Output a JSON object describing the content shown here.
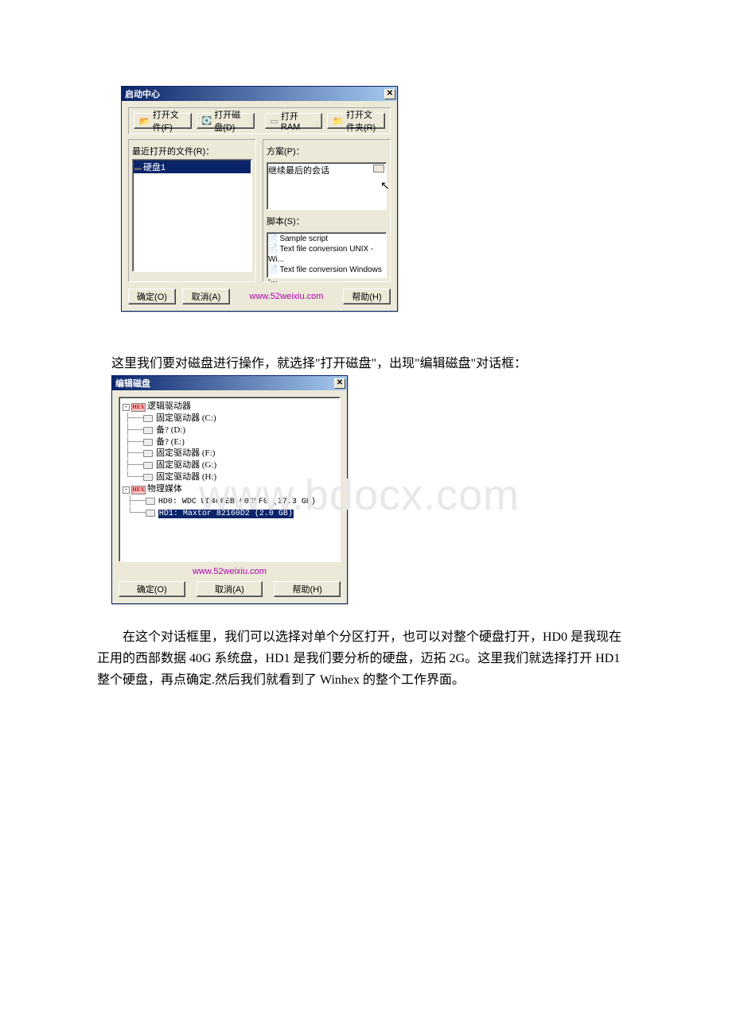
{
  "dialog1": {
    "title": "启动中心",
    "buttons": {
      "open_file": "打开文件(F)",
      "open_disk": "打开磁盘(D)",
      "open_ram": "打开 RAM",
      "open_folder": "打开文件夹(R)"
    },
    "recent_label": "最近打开的文件(R)：",
    "recent_items": [
      "硬盘1"
    ],
    "scheme_label": "方案(P)：",
    "scheme_items": [
      "继续最后的会话"
    ],
    "script_label": "脚本(S)：",
    "script_items": [
      "Sample script",
      "Text file conversion UNIX - Wi...",
      "Text file conversion Windows -..."
    ],
    "footer": {
      "ok": "确定(O)",
      "cancel": "取消(A)",
      "help": "帮助(H)",
      "link": "www.52weixiu.com"
    }
  },
  "para1": "这里我们要对磁盘进行操作，就选择\"打开磁盘\"，出现\"编辑磁盘\"对话框：",
  "dialog2": {
    "title": "编辑磁盘",
    "logical_label": "逻辑驱动器",
    "logical_drives": [
      "固定驱动器  (C:)",
      "备?  (D:)",
      "备?  (E:)",
      "固定驱动器  (F:)",
      "固定驱动器  (G:)",
      "固定驱动器  (H:)"
    ],
    "physical_label": "物理媒体",
    "physical_drives": [
      "HD0: WDC WD400EB-00CPF0 (37.3 GB)",
      "HD1: Maxtor 82160D2 (2.0 GB)"
    ],
    "link": "www.52weixiu.com",
    "footer": {
      "ok": "确定(O)",
      "cancel": "取消(A)",
      "help": "帮助(H)"
    }
  },
  "para2": "　　在这个对话框里，我们可以选择对单个分区打开，也可以对整个硬盘打开，HD0 是我现在正用的西部数据 40G 系统盘，HD1 是我们要分析的硬盘，迈拓 2G。这里我们就选择打开 HD1 整个硬盘，再点确定.然后我们就看到了 Winhex 的整个工作界面。",
  "watermark": "www.bdocx.com"
}
